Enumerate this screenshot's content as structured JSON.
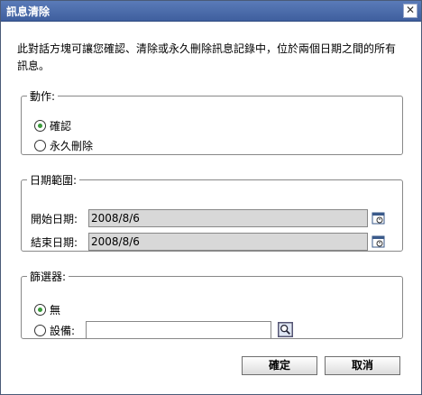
{
  "dialog": {
    "title": "訊息清除",
    "close": "✕",
    "description": "此對話方塊可讓您確認、清除或永久刪除訊息記錄中，位於兩個日期之間的所有訊息。"
  },
  "action": {
    "legend": "動作:",
    "options": [
      "確認",
      "永久刪除"
    ],
    "selected": "確認"
  },
  "date_range": {
    "legend": "日期範圍:",
    "start_label": "開始日期:",
    "start_value": "2008/8/6",
    "end_label": "結束日期:",
    "end_value": "2008/8/6"
  },
  "filter": {
    "legend": "篩選器:",
    "none_label": "無",
    "device_label": "設備:",
    "device_value": "",
    "selected": "無"
  },
  "buttons": {
    "ok": "確定",
    "cancel": "取消"
  }
}
